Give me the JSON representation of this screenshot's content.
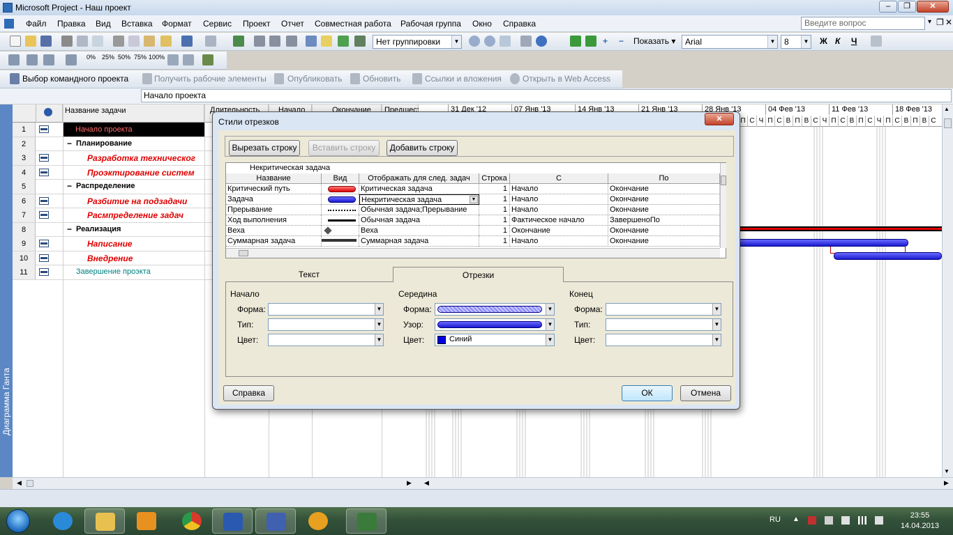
{
  "window": {
    "title": "Microsoft Project - Наш проект"
  },
  "menu": [
    "Файл",
    "Правка",
    "Вид",
    "Вставка",
    "Формат",
    "Сервис",
    "Проект",
    "Отчет",
    "Совместная работа",
    "Рабочая группа",
    "Окно",
    "Справка"
  ],
  "ask_placeholder": "Введите вопрос",
  "toolbar": {
    "grouping": "Нет группировки",
    "show_label": "Показать",
    "font": "Arial",
    "font_size": "8",
    "bold": "Ж",
    "italic": "К",
    "underline": "Ч",
    "pct": [
      "0%",
      "25%",
      "50%",
      "75%",
      "100%"
    ]
  },
  "team": {
    "select": "Выбор командного проекта",
    "get": "Получить рабочие элементы",
    "publish": "Опубликовать",
    "refresh": "Обновить",
    "links": "Ссылки и вложения",
    "web": "Открыть в Web Access"
  },
  "entry": "Начало проекта",
  "grid": {
    "headers": {
      "name": "Название задачи",
      "duration": "Длительность",
      "start": "Начало",
      "finish": "Окончание",
      "pred": "Предшест"
    },
    "rows": [
      {
        "n": "1",
        "name": "Начало проекта",
        "style": "selected"
      },
      {
        "n": "2",
        "name": "Планирование",
        "style": "summary"
      },
      {
        "n": "3",
        "name": "Разработка техническог",
        "style": "crit"
      },
      {
        "n": "4",
        "name": "Проэктирование систем",
        "style": "crit"
      },
      {
        "n": "5",
        "name": "Распределение",
        "style": "summary"
      },
      {
        "n": "6",
        "name": "Разбитие на подзадачи",
        "style": "crit"
      },
      {
        "n": "7",
        "name": "Расмпределение задач",
        "style": "crit"
      },
      {
        "n": "8",
        "name": "Реализация",
        "style": "summary"
      },
      {
        "n": "9",
        "name": "Написание",
        "style": "crit"
      },
      {
        "n": "10",
        "name": "Внедрение",
        "style": "crit"
      },
      {
        "n": "11",
        "name": "Завершение проэкта",
        "style": "milestone"
      }
    ]
  },
  "side_label": "Диаграмма Ганта",
  "gantt": {
    "weeks": [
      "31 Дек '12",
      "07 Янв '13",
      "14 Янв '13",
      "21 Янв '13",
      "28 Янв '13",
      "04 Фев '13",
      "11 Фев '13",
      "18 Фев '13"
    ],
    "days": [
      "П",
      "С",
      "Ч",
      "П",
      "С",
      "В",
      "П",
      "В",
      "С",
      "Ч",
      "П",
      "С",
      "В"
    ]
  },
  "dialog": {
    "title": "Стили отрезков",
    "cut": "Вырезать строку",
    "paste": "Вставить строку",
    "add": "Добавить строку",
    "editing": "Некритическая задача",
    "cols": [
      "Название",
      "Вид",
      "Отображать для след. задач",
      "Строка",
      "С",
      "По"
    ],
    "rows": [
      {
        "name": "Критический путь",
        "show": "Критическая задача",
        "row": "1",
        "from": "Начало",
        "to": "Окончание",
        "swatch": "red-bar"
      },
      {
        "name": "Задача",
        "show": "Некритическая задача",
        "row": "1",
        "from": "Начало",
        "to": "Окончание",
        "swatch": "blue-bar"
      },
      {
        "name": "Прерывание",
        "show": "Обычная задача;Прерывание",
        "row": "1",
        "from": "Начало",
        "to": "Окончание",
        "swatch": "dotted-line"
      },
      {
        "name": "Ход выполнения",
        "show": "Обычная задача",
        "row": "1",
        "from": "Фактическое начало",
        "to": "ЗавершеноПо",
        "swatch": "black-line"
      },
      {
        "name": "Веха",
        "show": "Веха",
        "row": "1",
        "from": "Окончание",
        "to": "Окончание",
        "swatch": "diamond"
      },
      {
        "name": "Суммарная задача",
        "show": "Суммарная задача",
        "row": "1",
        "from": "Начало",
        "to": "Окончание",
        "swatch": "summary-bracket"
      }
    ],
    "tabs": {
      "text": "Текст",
      "bars": "Отрезки"
    },
    "groups": {
      "start": "Начало",
      "middle": "Середина",
      "end": "Конец"
    },
    "labels": {
      "shape": "Форма:",
      "type": "Тип:",
      "color": "Цвет:",
      "pattern": "Узор:"
    },
    "middle_color": "Синий",
    "help": "Справка",
    "ok": "ОК",
    "cancel": "Отмена"
  },
  "taskbar": {
    "lang": "RU",
    "time": "23:55",
    "date": "14.04.2013"
  },
  "colors": {
    "crit": "#e00000",
    "task_blue": "#3333dd",
    "accent": "#5b87c5"
  }
}
